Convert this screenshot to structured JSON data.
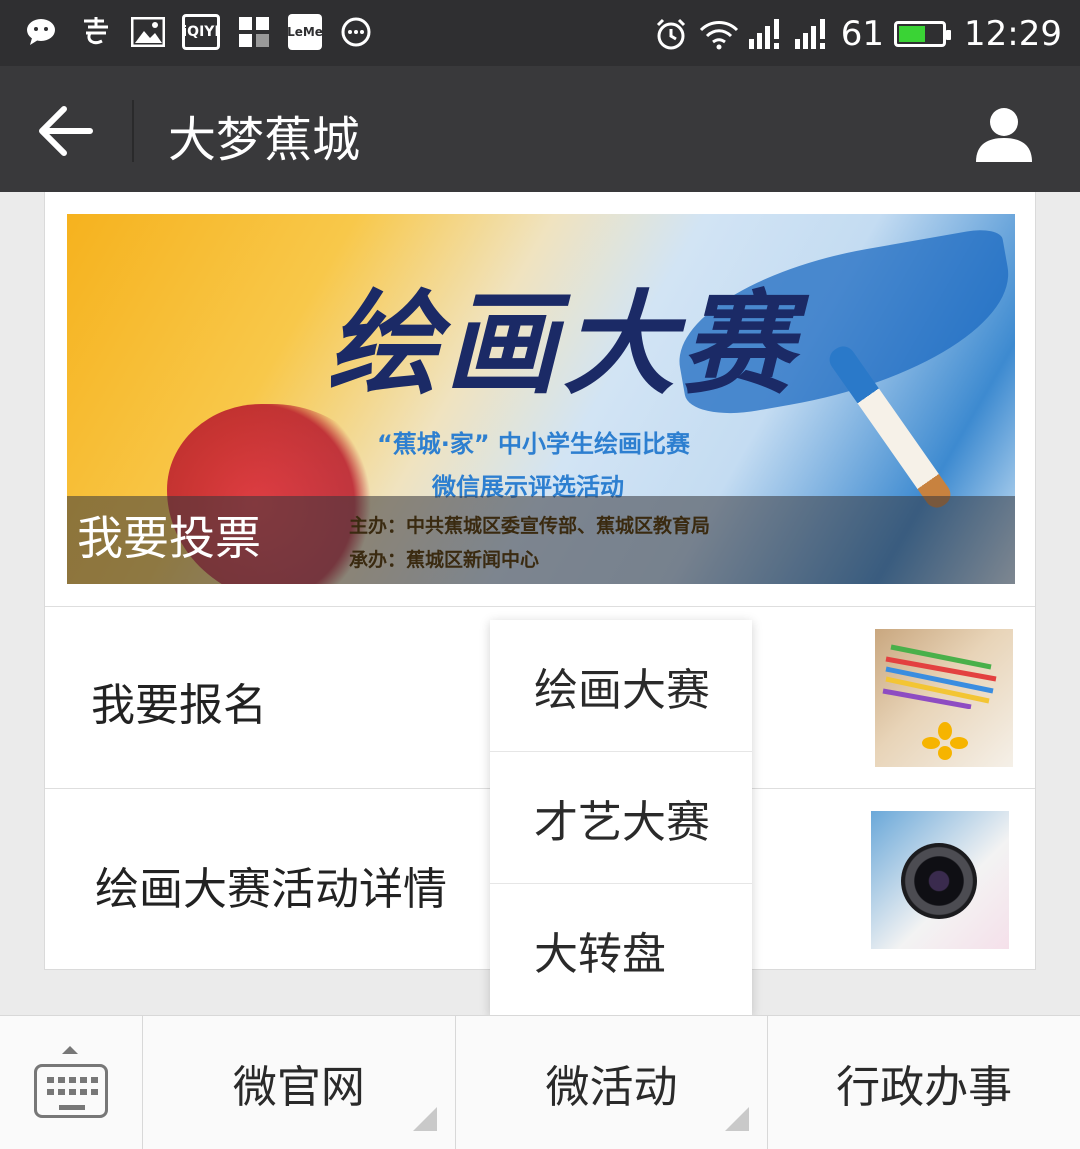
{
  "status_bar": {
    "left_icons": [
      "wechat-icon",
      "yixin-icon",
      "gallery-icon",
      "iqiyi-icon",
      "apps-icon",
      "leme-icon",
      "more-icon"
    ],
    "iqiyi_label": "iQIYI",
    "leme_label": "LeMe",
    "battery_level": "61",
    "time": "12:29",
    "battery_color": "#3ad335"
  },
  "header": {
    "title": "大梦蕉城"
  },
  "banner": {
    "title": "绘画大赛",
    "subtitle_line1": "“蕉城·家” 中小学生绘画比赛",
    "subtitle_line2": "微信展示评选活动",
    "host_line1": "主办：中共蕉城区委宣传部、蕉城区教育局",
    "host_line2": "承办：蕉城区新闻中心",
    "overlay_label": "我要投票"
  },
  "list": {
    "items": [
      {
        "label": "我要报名"
      },
      {
        "label": "绘画大赛活动详情"
      }
    ]
  },
  "popup_menu": {
    "items": [
      "绘画大赛",
      "才艺大赛",
      "大转盘"
    ]
  },
  "bottom_menu": {
    "items": [
      "微官网",
      "微活动",
      "行政办事"
    ]
  },
  "colors": {
    "status_bar_bg": "#2f2f31",
    "title_bar_bg": "#39393b",
    "page_bg": "#ebebeb"
  }
}
